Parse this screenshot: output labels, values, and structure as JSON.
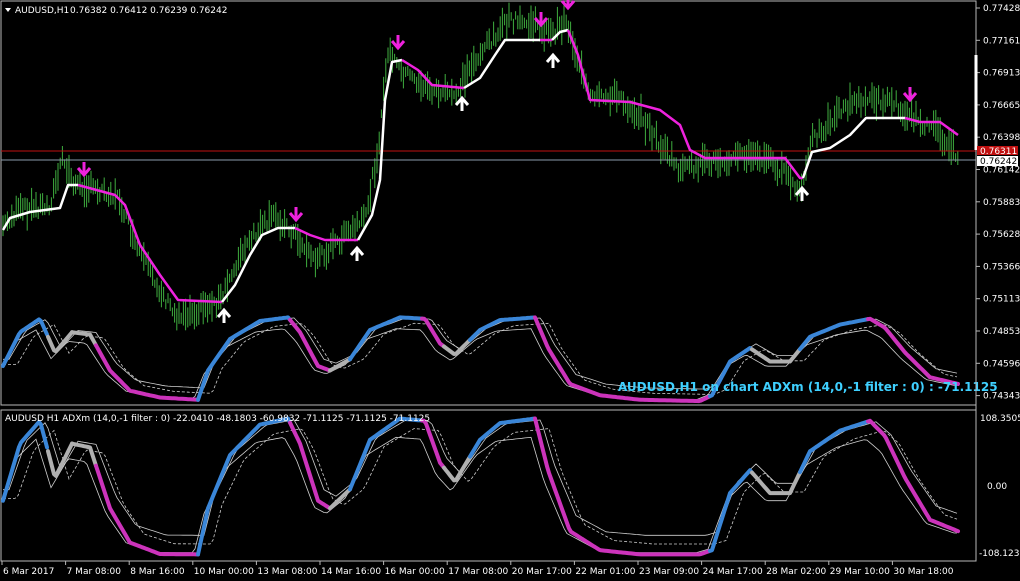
{
  "colors": {
    "background": "#000000",
    "frame": "#b8b8b8",
    "candle": "#3fae3f",
    "trend_up": "#ffffff",
    "trend_down": "#ee22dd",
    "adx_up": "#3a86d8",
    "adx_down": "#cc33bb",
    "adx_neutral": "#b0b0b0",
    "band": "#cfcfcf",
    "overlay_text": "#3fd0ff",
    "bid_line": "#c01010",
    "ask_line": "#8a9aaa"
  },
  "main_chart": {
    "title": "AUDUSD,H1",
    "ohlc": "0.76382 0.76412 0.76239 0.76242",
    "price_axis": [
      "0.77428",
      "0.77161",
      "0.76913",
      "0.76665",
      "0.76398",
      "0.76142",
      "0.75883",
      "0.75628",
      "0.75366",
      "0.75113",
      "0.74853",
      "0.74596",
      "0.74343"
    ],
    "price_badge_red": "0.76311",
    "price_badge_current": "0.76242",
    "overlay_label": "AUDUSD,H1 on chart ADXm (14,0,-1 filter : 0) : -71.1125",
    "arrow_icons": [
      "arrow-down-icon",
      "arrow-up-icon"
    ]
  },
  "sub_chart": {
    "label": "AUDUSD H1 ADXm (14,0,-1 filter : 0) -22.0410 -48.1803 -60.9832 -71.1125 -71.1125 -71.1125",
    "scale_top": "108.3505",
    "scale_mid": "0.00",
    "scale_bottom": "-108.1237"
  },
  "time_axis": [
    "6 Mar 2017",
    "7 Mar 08:00",
    "8 Mar 16:00",
    "10 Mar 00:00",
    "13 Mar 08:00",
    "14 Mar 16:00",
    "16 Mar 00:00",
    "17 Mar 08:00",
    "20 Mar 17:00",
    "22 Mar 01:00",
    "23 Mar 09:00",
    "24 Mar 17:00",
    "28 Mar 02:00",
    "29 Mar 10:00",
    "30 Mar 18:00"
  ]
}
